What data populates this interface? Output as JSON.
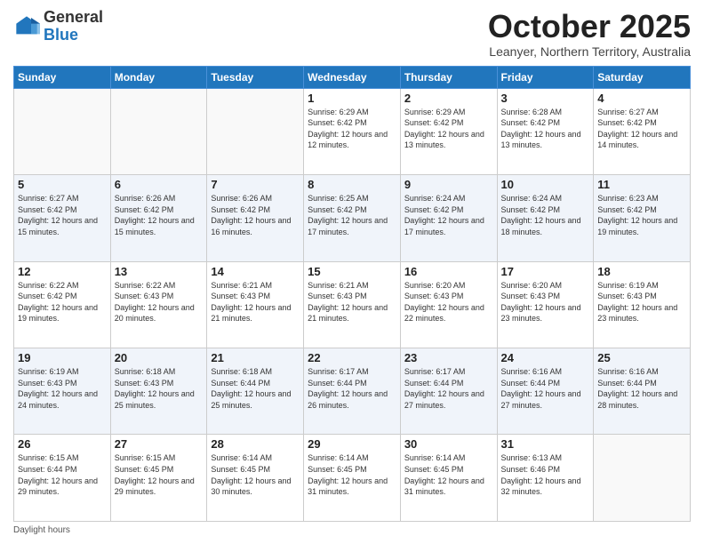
{
  "header": {
    "logo_general": "General",
    "logo_blue": "Blue",
    "month_title": "October 2025",
    "location": "Leanyer, Northern Territory, Australia"
  },
  "days_of_week": [
    "Sunday",
    "Monday",
    "Tuesday",
    "Wednesday",
    "Thursday",
    "Friday",
    "Saturday"
  ],
  "weeks": [
    [
      {
        "day": "",
        "sunrise": "",
        "sunset": "",
        "daylight": ""
      },
      {
        "day": "",
        "sunrise": "",
        "sunset": "",
        "daylight": ""
      },
      {
        "day": "",
        "sunrise": "",
        "sunset": "",
        "daylight": ""
      },
      {
        "day": "1",
        "sunrise": "Sunrise: 6:29 AM",
        "sunset": "Sunset: 6:42 PM",
        "daylight": "Daylight: 12 hours and 12 minutes."
      },
      {
        "day": "2",
        "sunrise": "Sunrise: 6:29 AM",
        "sunset": "Sunset: 6:42 PM",
        "daylight": "Daylight: 12 hours and 13 minutes."
      },
      {
        "day": "3",
        "sunrise": "Sunrise: 6:28 AM",
        "sunset": "Sunset: 6:42 PM",
        "daylight": "Daylight: 12 hours and 13 minutes."
      },
      {
        "day": "4",
        "sunrise": "Sunrise: 6:27 AM",
        "sunset": "Sunset: 6:42 PM",
        "daylight": "Daylight: 12 hours and 14 minutes."
      }
    ],
    [
      {
        "day": "5",
        "sunrise": "Sunrise: 6:27 AM",
        "sunset": "Sunset: 6:42 PM",
        "daylight": "Daylight: 12 hours and 15 minutes."
      },
      {
        "day": "6",
        "sunrise": "Sunrise: 6:26 AM",
        "sunset": "Sunset: 6:42 PM",
        "daylight": "Daylight: 12 hours and 15 minutes."
      },
      {
        "day": "7",
        "sunrise": "Sunrise: 6:26 AM",
        "sunset": "Sunset: 6:42 PM",
        "daylight": "Daylight: 12 hours and 16 minutes."
      },
      {
        "day": "8",
        "sunrise": "Sunrise: 6:25 AM",
        "sunset": "Sunset: 6:42 PM",
        "daylight": "Daylight: 12 hours and 17 minutes."
      },
      {
        "day": "9",
        "sunrise": "Sunrise: 6:24 AM",
        "sunset": "Sunset: 6:42 PM",
        "daylight": "Daylight: 12 hours and 17 minutes."
      },
      {
        "day": "10",
        "sunrise": "Sunrise: 6:24 AM",
        "sunset": "Sunset: 6:42 PM",
        "daylight": "Daylight: 12 hours and 18 minutes."
      },
      {
        "day": "11",
        "sunrise": "Sunrise: 6:23 AM",
        "sunset": "Sunset: 6:42 PM",
        "daylight": "Daylight: 12 hours and 19 minutes."
      }
    ],
    [
      {
        "day": "12",
        "sunrise": "Sunrise: 6:22 AM",
        "sunset": "Sunset: 6:42 PM",
        "daylight": "Daylight: 12 hours and 19 minutes."
      },
      {
        "day": "13",
        "sunrise": "Sunrise: 6:22 AM",
        "sunset": "Sunset: 6:43 PM",
        "daylight": "Daylight: 12 hours and 20 minutes."
      },
      {
        "day": "14",
        "sunrise": "Sunrise: 6:21 AM",
        "sunset": "Sunset: 6:43 PM",
        "daylight": "Daylight: 12 hours and 21 minutes."
      },
      {
        "day": "15",
        "sunrise": "Sunrise: 6:21 AM",
        "sunset": "Sunset: 6:43 PM",
        "daylight": "Daylight: 12 hours and 21 minutes."
      },
      {
        "day": "16",
        "sunrise": "Sunrise: 6:20 AM",
        "sunset": "Sunset: 6:43 PM",
        "daylight": "Daylight: 12 hours and 22 minutes."
      },
      {
        "day": "17",
        "sunrise": "Sunrise: 6:20 AM",
        "sunset": "Sunset: 6:43 PM",
        "daylight": "Daylight: 12 hours and 23 minutes."
      },
      {
        "day": "18",
        "sunrise": "Sunrise: 6:19 AM",
        "sunset": "Sunset: 6:43 PM",
        "daylight": "Daylight: 12 hours and 23 minutes."
      }
    ],
    [
      {
        "day": "19",
        "sunrise": "Sunrise: 6:19 AM",
        "sunset": "Sunset: 6:43 PM",
        "daylight": "Daylight: 12 hours and 24 minutes."
      },
      {
        "day": "20",
        "sunrise": "Sunrise: 6:18 AM",
        "sunset": "Sunset: 6:43 PM",
        "daylight": "Daylight: 12 hours and 25 minutes."
      },
      {
        "day": "21",
        "sunrise": "Sunrise: 6:18 AM",
        "sunset": "Sunset: 6:44 PM",
        "daylight": "Daylight: 12 hours and 25 minutes."
      },
      {
        "day": "22",
        "sunrise": "Sunrise: 6:17 AM",
        "sunset": "Sunset: 6:44 PM",
        "daylight": "Daylight: 12 hours and 26 minutes."
      },
      {
        "day": "23",
        "sunrise": "Sunrise: 6:17 AM",
        "sunset": "Sunset: 6:44 PM",
        "daylight": "Daylight: 12 hours and 27 minutes."
      },
      {
        "day": "24",
        "sunrise": "Sunrise: 6:16 AM",
        "sunset": "Sunset: 6:44 PM",
        "daylight": "Daylight: 12 hours and 27 minutes."
      },
      {
        "day": "25",
        "sunrise": "Sunrise: 6:16 AM",
        "sunset": "Sunset: 6:44 PM",
        "daylight": "Daylight: 12 hours and 28 minutes."
      }
    ],
    [
      {
        "day": "26",
        "sunrise": "Sunrise: 6:15 AM",
        "sunset": "Sunset: 6:44 PM",
        "daylight": "Daylight: 12 hours and 29 minutes."
      },
      {
        "day": "27",
        "sunrise": "Sunrise: 6:15 AM",
        "sunset": "Sunset: 6:45 PM",
        "daylight": "Daylight: 12 hours and 29 minutes."
      },
      {
        "day": "28",
        "sunrise": "Sunrise: 6:14 AM",
        "sunset": "Sunset: 6:45 PM",
        "daylight": "Daylight: 12 hours and 30 minutes."
      },
      {
        "day": "29",
        "sunrise": "Sunrise: 6:14 AM",
        "sunset": "Sunset: 6:45 PM",
        "daylight": "Daylight: 12 hours and 31 minutes."
      },
      {
        "day": "30",
        "sunrise": "Sunrise: 6:14 AM",
        "sunset": "Sunset: 6:45 PM",
        "daylight": "Daylight: 12 hours and 31 minutes."
      },
      {
        "day": "31",
        "sunrise": "Sunrise: 6:13 AM",
        "sunset": "Sunset: 6:46 PM",
        "daylight": "Daylight: 12 hours and 32 minutes."
      },
      {
        "day": "",
        "sunrise": "",
        "sunset": "",
        "daylight": ""
      }
    ]
  ],
  "footer": {
    "daylight_label": "Daylight hours"
  }
}
